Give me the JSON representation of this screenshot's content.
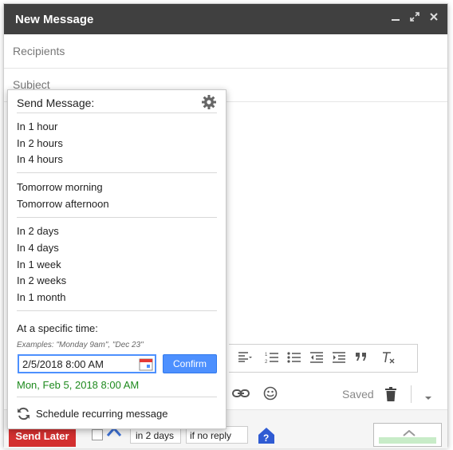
{
  "compose": {
    "title": "New Message",
    "recipients_placeholder": "Recipients",
    "subject_placeholder": "Subject",
    "saved_label": "Saved"
  },
  "footer": {
    "send_later_label": "Send Later",
    "delay_value": "in 2 days",
    "reply_condition": "if no reply"
  },
  "popup": {
    "header": "Send Message:",
    "groups": [
      [
        "In 1 hour",
        "In 2 hours",
        "In 4 hours"
      ],
      [
        "Tomorrow morning",
        "Tomorrow afternoon"
      ],
      [
        "In 2 days",
        "In 4 days",
        "In 1 week",
        "In 2 weeks",
        "In 1 month"
      ]
    ],
    "specific_time_label": "At a specific time:",
    "examples": "Examples: \"Monday 9am\", \"Dec 23\"",
    "datetime_value": "2/5/2018 8:00 AM",
    "confirm_label": "Confirm",
    "parsed_value": "Mon, Feb 5, 2018 8:00 AM",
    "recurring_label": "Schedule recurring message"
  },
  "colors": {
    "titlebar": "#404040",
    "accent_blue": "#4d90fe",
    "send_later_red": "#d32f2f",
    "parsed_green": "#1e8a1e"
  }
}
